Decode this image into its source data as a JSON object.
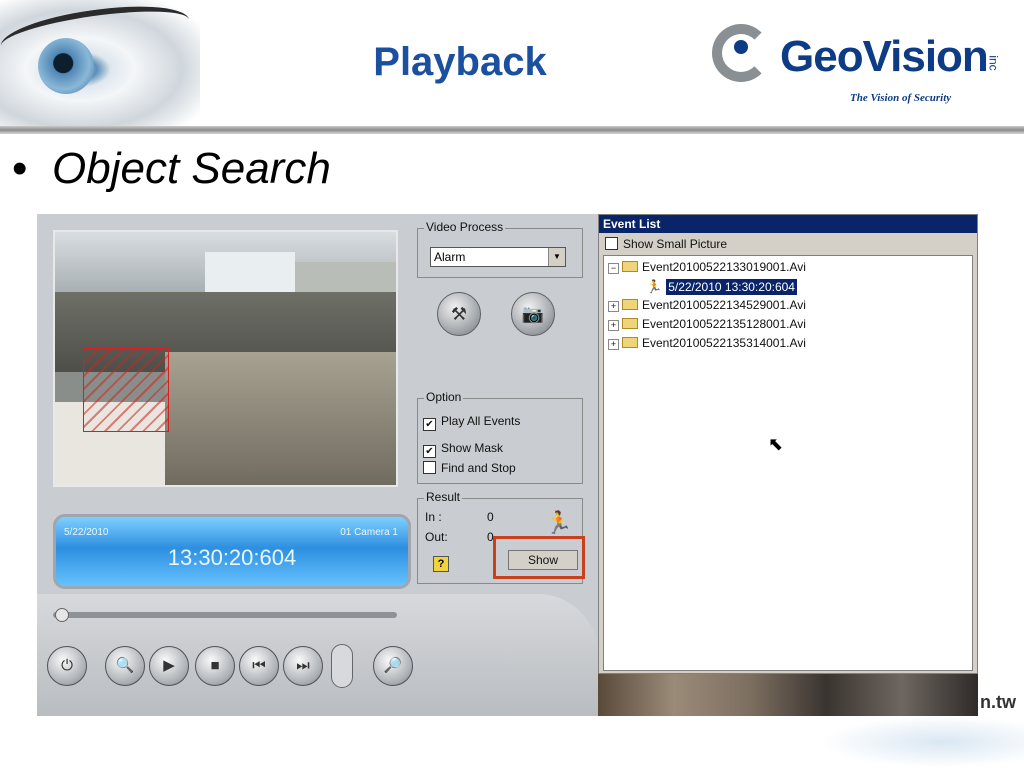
{
  "header": {
    "title": "Playback",
    "logo_text": "GeoVision",
    "logo_inc": "inc",
    "logo_tagline": "The Vision of Security"
  },
  "slide": {
    "bullet": "•",
    "subtitle": "Object Search"
  },
  "player": {
    "lcd_date": "5/22/2010",
    "lcd_camera": "01 Camera 1",
    "lcd_time": "13:30:20:604",
    "video_process": {
      "label": "Video Process",
      "selected": "Alarm"
    },
    "option": {
      "label": "Option",
      "items": [
        {
          "label": "Play All Events",
          "checked": true
        },
        {
          "label": "Show Mask",
          "checked": true
        },
        {
          "label": "Find and Stop",
          "checked": false
        }
      ]
    },
    "result": {
      "label": "Result",
      "in_label": "In :",
      "in_value": "0",
      "out_label": "Out:",
      "out_value": "0",
      "show_label": "Show"
    },
    "controls": [
      "power-icon",
      "zoom-icon",
      "play-icon",
      "stop-icon",
      "prev-frame-icon",
      "next-frame-icon",
      "snapshot-search-icon"
    ]
  },
  "event_list": {
    "title": "Event List",
    "show_small_picture": "Show Small Picture",
    "show_small_picture_checked": false,
    "items": [
      {
        "label": "Event20100522133019001.Avi",
        "expanded": true
      },
      {
        "label": "5/22/2010 13:30:20:604",
        "selected": true
      },
      {
        "label": "Event20100522134529001.Avi",
        "expanded": false
      },
      {
        "label": "Event20100522135128001.Avi",
        "expanded": false
      },
      {
        "label": "Event20100522135314001.Avi",
        "expanded": false
      }
    ]
  },
  "footer": {
    "url_tail": "n.tw"
  },
  "colors": {
    "title_blue": "#1b4fa0",
    "highlight_red": "#c8401e",
    "selection_navy": "#0a246a"
  }
}
